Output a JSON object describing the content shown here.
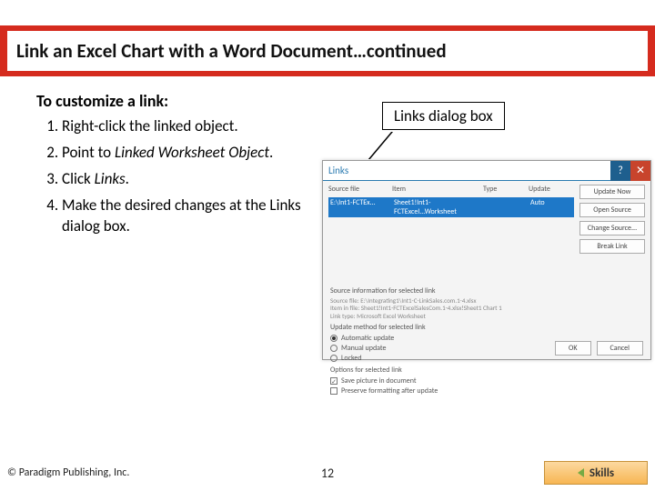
{
  "title": "Link an Excel Chart with a Word Document…continued",
  "subtitle": "To customize a link:",
  "steps": [
    {
      "pre": "Right-click the linked object."
    },
    {
      "pre": "Point to ",
      "em": "Linked Worksheet Object",
      "post": "."
    },
    {
      "pre": "Click ",
      "em": "Links",
      "post": "."
    },
    {
      "pre": "Make the desired changes at the Links dialog box."
    }
  ],
  "callout": "Links dialog box",
  "dialog": {
    "title": "Links",
    "help": "?",
    "close": "✕",
    "headers": [
      "Source file",
      "Item",
      "Type",
      "Update"
    ],
    "row": [
      "E:\\Int1-FCTEx...",
      "Sheet1!Int1-FCTExcel...Worksheet",
      "",
      "Auto"
    ],
    "side_buttons": [
      "Update Now",
      "Open Source",
      "Change Source...",
      "Break Link"
    ],
    "info_label": "Source information for selected link",
    "info_lines": [
      "Source file:  E:\\Integrating1\\Int1-C-LinkSales.com.1-4.xlsx",
      "Item in file:  Sheet1!Int1-FCTExcelSalesCom.1-4.xlsx!Sheet1 Chart 1",
      "Link type:  Microsoft Excel Worksheet"
    ],
    "update_label": "Update method for selected link",
    "radios": [
      {
        "label": "Automatic update",
        "selected": true
      },
      {
        "label": "Manual update",
        "selected": false
      },
      {
        "label": "Locked",
        "selected": false
      }
    ],
    "options_label": "Options for selected link",
    "checks": [
      {
        "label": "Save picture in document",
        "checked": true
      },
      {
        "label": "Preserve formatting after update",
        "checked": false
      }
    ],
    "ok": "OK",
    "cancel": "Cancel"
  },
  "footer": {
    "copyright": "© Paradigm Publishing, Inc.",
    "page": "12",
    "skills": "Skills"
  }
}
